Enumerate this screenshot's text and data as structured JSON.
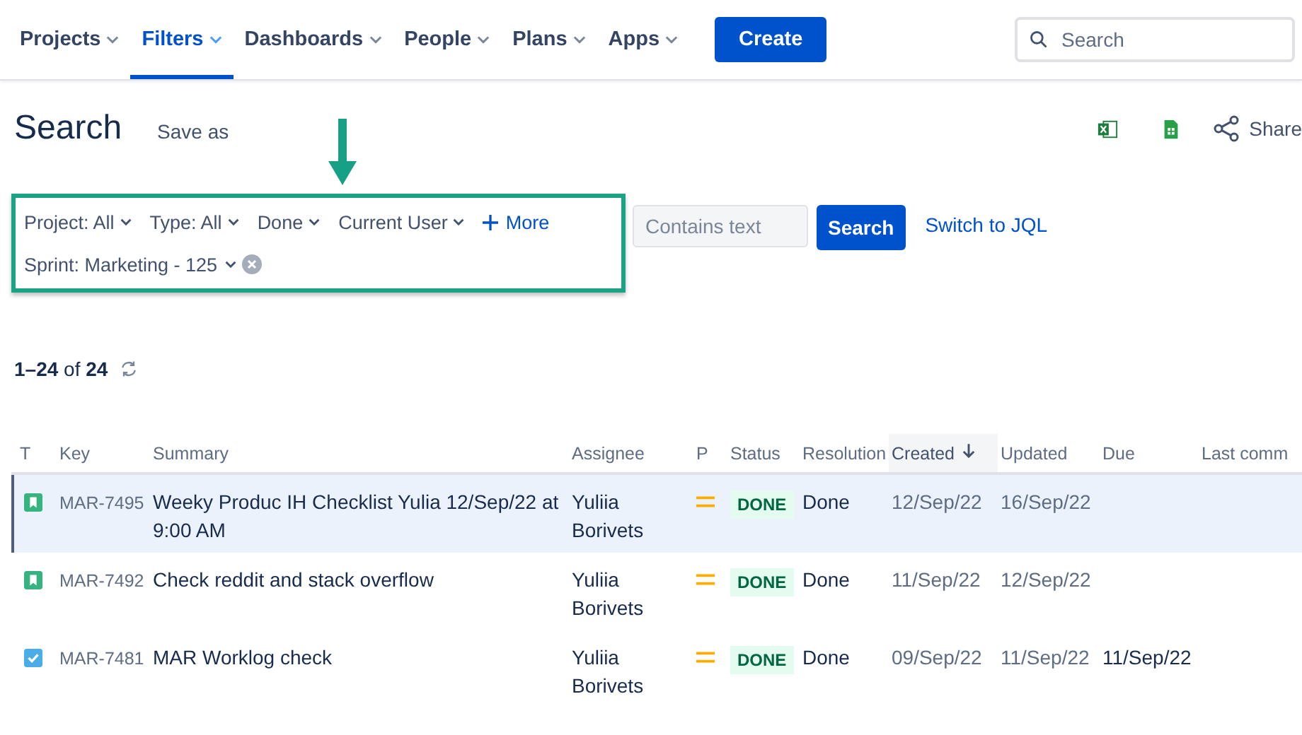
{
  "nav": {
    "items": [
      {
        "label": "Projects",
        "selected": false
      },
      {
        "label": "Filters",
        "selected": true
      },
      {
        "label": "Dashboards",
        "selected": false
      },
      {
        "label": "People",
        "selected": false
      },
      {
        "label": "Plans",
        "selected": false
      },
      {
        "label": "Apps",
        "selected": false
      }
    ],
    "create_button": "Create",
    "search": {
      "placeholder": "Search"
    }
  },
  "page": {
    "title": "Search",
    "save_as": "Save as",
    "share": "Share"
  },
  "filters": {
    "items": [
      {
        "label": "Project: All",
        "kind": "dropdown"
      },
      {
        "label": "Type: All",
        "kind": "dropdown"
      },
      {
        "label": "Done",
        "kind": "dropdown"
      },
      {
        "label": "Current User",
        "kind": "dropdown"
      },
      {
        "label": "More",
        "kind": "add"
      },
      {
        "label": "Sprint: Marketing - 125",
        "kind": "removable"
      }
    ],
    "text": {
      "placeholder": "Contains text"
    },
    "search_button": "Search",
    "switch_link": "Switch to JQL"
  },
  "count": "**1–24** of **24**",
  "table": {
    "columns": [
      {
        "label": "T",
        "sorted": false
      },
      {
        "label": "Key",
        "sorted": false
      },
      {
        "label": "Summary",
        "sorted": false
      },
      {
        "label": "Assignee",
        "sorted": false
      },
      {
        "label": "P",
        "sorted": false
      },
      {
        "label": "Status",
        "sorted": false
      },
      {
        "label": "Resolution",
        "sorted": false
      },
      {
        "label": "Created",
        "sorted": true
      },
      {
        "label": "Updated",
        "sorted": false
      },
      {
        "label": "Due",
        "sorted": false
      },
      {
        "label": "Last comm",
        "sorted": false
      }
    ],
    "rows": [
      {
        "kind": "story",
        "key": "MAR-7495",
        "summary": "Weeky Produc IH Checklist Yulia 12/Sep/22 at 9:00 AM",
        "assignee": "Yuliia Borivets",
        "status": "DONE",
        "resolution": "Done",
        "created": "12/Sep/22",
        "updated": "16/Sep/22",
        "selected": true
      },
      {
        "kind": "story",
        "key": "MAR-7492",
        "summary": "Check reddit and stack overflow",
        "assignee": "Yuliia Borivets",
        "status": "DONE",
        "resolution": "Done",
        "created": "11/Sep/22",
        "updated": "12/Sep/22",
        "selected": false
      },
      {
        "kind": "task",
        "key": "MAR-7481",
        "summary": "MAR Worklog check",
        "assignee": "Yuliia Borivets",
        "status": "DONE",
        "resolution": "Done",
        "created": "09/Sep/22",
        "updated": "11/Sep/22",
        "due": "11/Sep/22",
        "selected": false
      }
    ]
  }
}
